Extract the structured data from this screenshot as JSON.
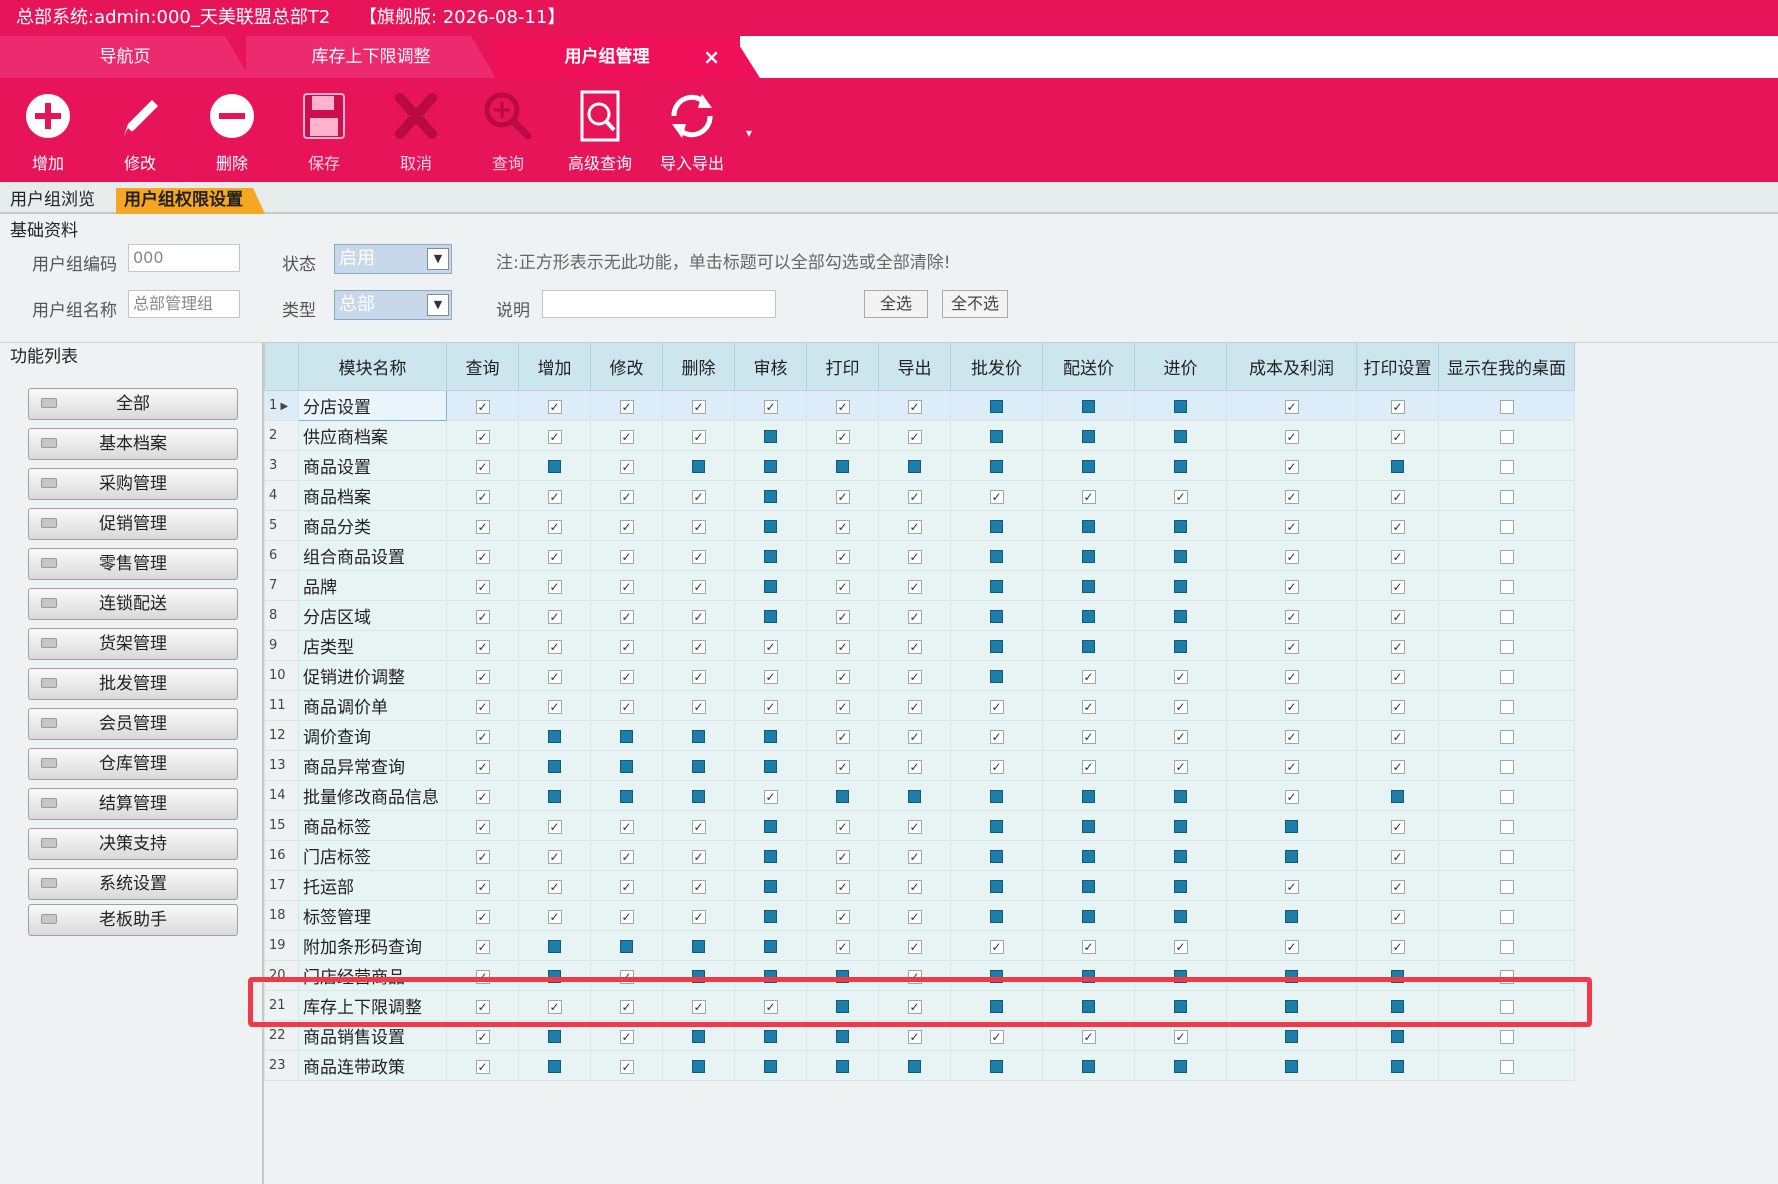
{
  "title": "总部系统:admin:000_天美联盟总部T2     【旗舰版: 2026-08-11】",
  "tabs": [
    {
      "label": "导航页"
    },
    {
      "label": "库存上下限调整"
    },
    {
      "label": "用户组管理",
      "close": "×"
    }
  ],
  "toolbar": [
    {
      "label": "增加",
      "icon": "plus-circle-icon"
    },
    {
      "label": "修改",
      "icon": "pencil-icon"
    },
    {
      "label": "删除",
      "icon": "minus-circle-icon"
    },
    {
      "label": "保存",
      "icon": "save-disk-icon"
    },
    {
      "label": "取消",
      "icon": "x-icon"
    },
    {
      "label": "查询",
      "icon": "zoom-icon"
    },
    {
      "label": "高级查询",
      "icon": "advanced-search-icon"
    },
    {
      "label": "导入导出",
      "icon": "refresh-icon"
    }
  ],
  "subtabs": {
    "browse": "用户组浏览",
    "perm": "用户组权限设置"
  },
  "basic": {
    "section": "基础资料",
    "code_label": "用户组编码",
    "code_value": "000",
    "name_label": "用户组名称",
    "name_value": "总部管理组",
    "status_label": "状态",
    "status_value": "启用",
    "type_label": "类型",
    "type_value": "总部",
    "note": "注:正方形表示无此功能，单击标题可以全部勾选或全部清除!",
    "desc_label": "说明",
    "select_all": "全选",
    "select_none": "全不选"
  },
  "sidebar": {
    "title": "功能列表",
    "items": [
      "全部",
      "基本档案",
      "采购管理",
      "促销管理",
      "零售管理",
      "连锁配送",
      "货架管理",
      "批发管理",
      "会员管理",
      "仓库管理",
      "结算管理",
      "决策支持",
      "系统设置",
      "老板助手"
    ]
  },
  "grid": {
    "headers": [
      "模块名称",
      "查询",
      "增加",
      "修改",
      "删除",
      "审核",
      "打印",
      "导出",
      "批发价",
      "配送价",
      "进价",
      "成本及利润",
      "打印设置",
      "显示在我的桌面"
    ],
    "legend": {
      "c": "checked",
      "s": "no-function",
      "u": "unchecked"
    },
    "rows": [
      {
        "n": "1",
        "name": "分店设置",
        "p": "ccccccc sss ccu"
      },
      {
        "n": "2",
        "name": "供应商档案",
        "p": "ccccscc sss ccu"
      },
      {
        "n": "3",
        "name": "商品设置",
        "p": "cscssss sss csu"
      },
      {
        "n": "4",
        "name": "商品档案",
        "p": "ccccscc ccc ccu"
      },
      {
        "n": "5",
        "name": "商品分类",
        "p": "ccccscc sss ccu"
      },
      {
        "n": "6",
        "name": "组合商品设置",
        "p": "ccccscc sss ccu"
      },
      {
        "n": "7",
        "name": "品牌",
        "p": "ccccscc sss ccu"
      },
      {
        "n": "8",
        "name": "分店区域",
        "p": "ccccscc sss ccu"
      },
      {
        "n": "9",
        "name": "店类型",
        "p": "ccccccc sss ccu"
      },
      {
        "n": "10",
        "name": "促销进价调整",
        "p": "ccccccc scc ccu"
      },
      {
        "n": "11",
        "name": "商品调价单",
        "p": "ccccccc ccc ccu"
      },
      {
        "n": "12",
        "name": "调价查询",
        "p": "csssscc ccc ccu"
      },
      {
        "n": "13",
        "name": "商品异常查询",
        "p": "csssscc ccc ccu"
      },
      {
        "n": "14",
        "name": "批量修改商品信息",
        "p": "cssscss sss csu"
      },
      {
        "n": "15",
        "name": "商品标签",
        "p": "ccccscc sss scu"
      },
      {
        "n": "16",
        "name": "门店标签",
        "p": "ccccscc sss scu"
      },
      {
        "n": "17",
        "name": "托运部",
        "p": "ccccscc sss ccu"
      },
      {
        "n": "18",
        "name": "标签管理",
        "p": "ccccscc sss scu"
      },
      {
        "n": "19",
        "name": "附加条形码查询",
        "p": "csssscc ccc ccu"
      },
      {
        "n": "20",
        "name": "门店经营商品",
        "p": "cscsssc sss ssu"
      },
      {
        "n": "21",
        "name": "库存上下限调整",
        "p": "cccccsc sss ssu"
      },
      {
        "n": "22",
        "name": "商品销售设置",
        "p": "cscsssc ccc ssu"
      },
      {
        "n": "23",
        "name": "商品连带政策",
        "p": "cscssss sss ssu"
      }
    ]
  },
  "colors": {
    "brand": "#e8145a",
    "subtab_active": "#f5a623",
    "highlight": "#f03a4a",
    "no_function_square": "#1e7ea8"
  }
}
